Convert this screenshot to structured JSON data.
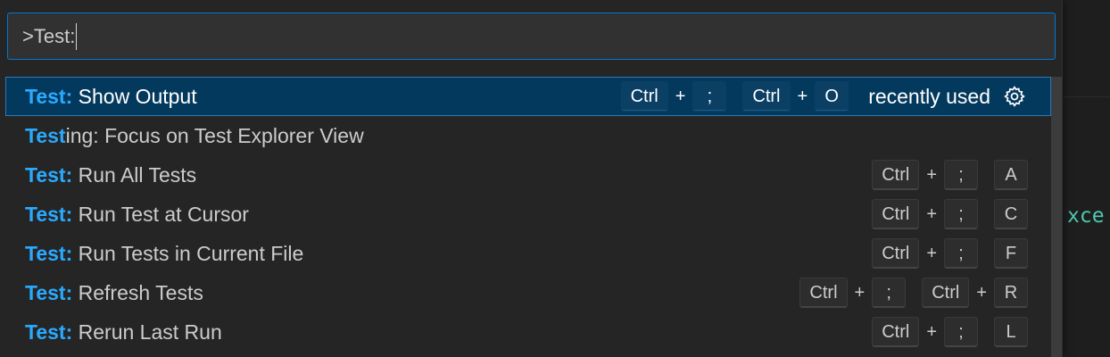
{
  "quick_open": {
    "input_value": ">Test:",
    "items": [
      {
        "highlight": "Test:",
        "rest": " Show Output",
        "selected": true,
        "keybindings": [
          [
            "Ctrl",
            ";"
          ],
          [
            "Ctrl",
            "O"
          ]
        ],
        "detail": "recently used",
        "action_icon": "gear-icon"
      },
      {
        "highlight": "Test",
        "rest": "ing: Focus on Test Explorer View",
        "selected": false,
        "keybindings": []
      },
      {
        "highlight": "Test:",
        "rest": " Run All Tests",
        "selected": false,
        "keybindings": [
          [
            "Ctrl",
            ";"
          ],
          [
            "A"
          ]
        ]
      },
      {
        "highlight": "Test:",
        "rest": " Run Test at Cursor",
        "selected": false,
        "keybindings": [
          [
            "Ctrl",
            ";"
          ],
          [
            "C"
          ]
        ]
      },
      {
        "highlight": "Test:",
        "rest": " Run Tests in Current File",
        "selected": false,
        "keybindings": [
          [
            "Ctrl",
            ";"
          ],
          [
            "F"
          ]
        ]
      },
      {
        "highlight": "Test:",
        "rest": " Refresh Tests",
        "selected": false,
        "keybindings": [
          [
            "Ctrl",
            ";"
          ],
          [
            "Ctrl",
            "R"
          ]
        ]
      },
      {
        "highlight": "Test:",
        "rest": " Rerun Last Run",
        "selected": false,
        "keybindings": [
          [
            "Ctrl",
            ";"
          ],
          [
            "L"
          ]
        ]
      }
    ]
  },
  "editor": {
    "visible_text": "xce"
  },
  "colors": {
    "accent": "#0078d4",
    "highlight": "#2aaaff",
    "selected_row": "#04395e",
    "code_text": "#4ec9b0"
  }
}
